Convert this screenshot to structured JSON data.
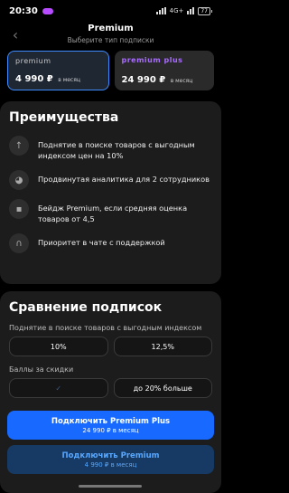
{
  "status": {
    "time": "20:30",
    "net": "4G+",
    "battery": "77"
  },
  "header": {
    "back_icon": "chevron-left-icon",
    "title": "Premium",
    "subtitle": "Выберите тип подписки"
  },
  "plans": [
    {
      "logo": "premium",
      "price": "4 990 ₽",
      "period": "в месяц"
    },
    {
      "logo": "premium plus",
      "price": "24 990 ₽",
      "period": "в месяц"
    }
  ],
  "benefits": {
    "title": "Преимущества",
    "items": [
      {
        "icon": "arrow-up-icon",
        "text": "Поднятие в поиске товаров с выгодным индексом цен на 10%"
      },
      {
        "icon": "pie-chart-icon",
        "text": "Продвинутая аналитика для 2 сотрудников"
      },
      {
        "icon": "chat-icon",
        "text": "Бейдж Premium, если средняя оценка товаров от 4,5"
      },
      {
        "icon": "headset-icon",
        "text": "Приоритет в чате с поддержкой"
      }
    ]
  },
  "compare": {
    "title": "Сравнение подписок",
    "rows": [
      {
        "label": "Поднятие в поиске товаров с выгодным индексом",
        "premium": "10%",
        "plus": "12,5%"
      },
      {
        "label": "Баллы за скидки",
        "premium": "",
        "plus": "до 20% больше"
      }
    ]
  },
  "cta": {
    "plus": {
      "title": "Подключить Premium Plus",
      "price": "24 990 ₽ в месяц"
    },
    "basic": {
      "title": "Подключить Premium",
      "price": "4 990 ₽ в месяц"
    }
  },
  "colors": {
    "accent": "#1769ff",
    "plus_logo": "#a86cff",
    "selected_border": "#3d8bff"
  }
}
